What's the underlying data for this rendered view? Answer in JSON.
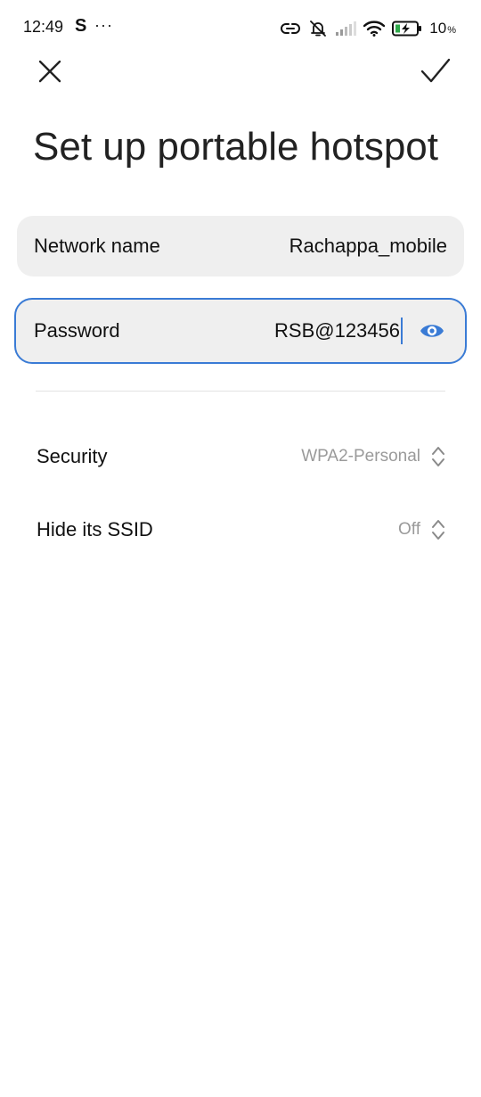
{
  "status_bar": {
    "time": "12:49",
    "app_indicator": "S",
    "more_indicator": "···",
    "battery_level": "10",
    "battery_unit": "%",
    "icons": [
      "link-icon",
      "silent-icon",
      "signal-icon",
      "wifi-icon",
      "battery-charging-icon"
    ]
  },
  "header": {
    "close_icon": "close-icon",
    "confirm_icon": "checkmark-icon"
  },
  "title": "Set up portable hotspot",
  "fields": {
    "network_name": {
      "label": "Network name",
      "value": "Rachappa_mobile"
    },
    "password": {
      "label": "Password",
      "value": "RSB@123456",
      "visibility_icon": "eye-icon"
    }
  },
  "settings": {
    "security": {
      "label": "Security",
      "value": "WPA2-Personal"
    },
    "hide_ssid": {
      "label": "Hide its SSID",
      "value": "Off"
    }
  },
  "colors": {
    "accent": "#3a7bd5",
    "field_background": "#efefef",
    "secondary_text": "#9a9a9a"
  }
}
